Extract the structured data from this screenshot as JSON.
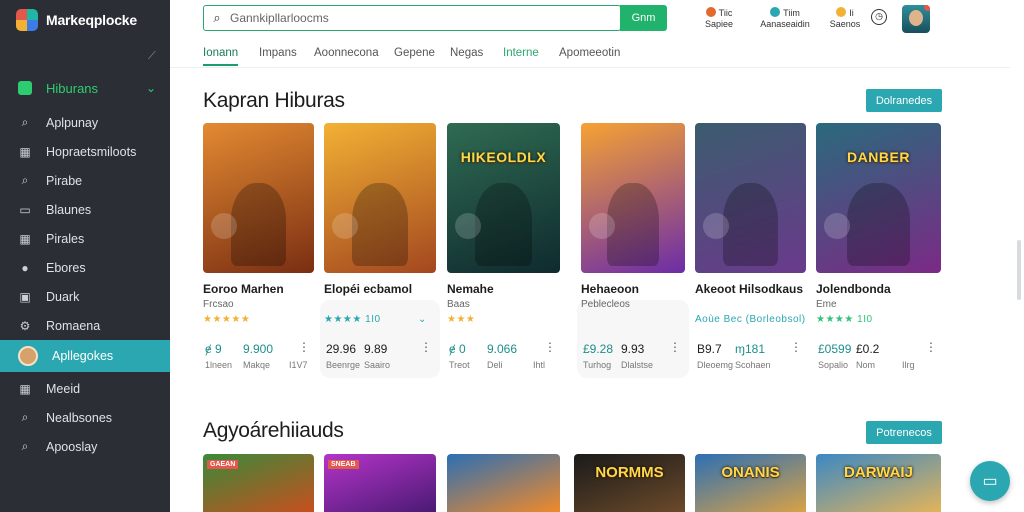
{
  "app": {
    "name": "Markeqplocke"
  },
  "sidebar": {
    "section": {
      "label": "Hiburans"
    },
    "items": [
      {
        "label": "Aplpunay",
        "icon": "search-icon"
      },
      {
        "label": "Hopraetsmiloots",
        "icon": "grid-icon"
      },
      {
        "label": "Pirabe",
        "icon": "search-icon"
      },
      {
        "label": "Blaunes",
        "icon": "chat-icon"
      },
      {
        "label": "Pirales",
        "icon": "grid-icon"
      },
      {
        "label": "Ebores",
        "icon": "user-icon"
      },
      {
        "label": "Duark",
        "icon": "monitor-icon"
      },
      {
        "label": "Romaena",
        "icon": "settings-icon"
      },
      {
        "label": "Apllegokes",
        "icon": "avatar-icon",
        "active": true
      },
      {
        "label": "Meeid",
        "icon": "grid-icon"
      },
      {
        "label": "Nealbsones",
        "icon": "search-icon"
      },
      {
        "label": "Apooslay",
        "icon": "search-icon"
      }
    ]
  },
  "search": {
    "placeholder": "Gannkipllarloocms",
    "button_label": "Gnm"
  },
  "topbar": {
    "stats": [
      {
        "top": "Tiic",
        "bottom": "Sapiee",
        "color": "#e26a2c"
      },
      {
        "top": "Tiim",
        "bottom": "Aanaseaidin",
        "color": "#2aa7b0"
      },
      {
        "top": "Ii",
        "bottom": "Saenos",
        "color": "#f2b134"
      }
    ]
  },
  "tabs": [
    {
      "label": "Ionann",
      "active": true
    },
    {
      "label": "Impans"
    },
    {
      "label": "Aoonnecona"
    },
    {
      "label": "Gepene"
    },
    {
      "label": "Negas"
    },
    {
      "label": "Interne",
      "green": true
    },
    {
      "label": "Apomeeotin"
    }
  ],
  "sections": [
    {
      "title": "Kapran Hiburas",
      "button": "Dolranedes"
    },
    {
      "title": "Agyoárehiiauds",
      "button": "Potrenecos"
    }
  ],
  "cards": [
    {
      "title": "Eoroo Marhen",
      "subtitle": "Frcsao",
      "rating": "★★★★★",
      "rating_style": "gold",
      "stats": [
        {
          "value": "ɇ 9",
          "label": "1lneen",
          "teal": true
        },
        {
          "value": "9.900",
          "label": "Makqe",
          "teal": true
        }
      ],
      "extra": "I1V7",
      "colors": [
        "#e38a32",
        "#7a2e12"
      ],
      "logo": ""
    },
    {
      "title": "Elopéi ecbamol",
      "subtitle": "",
      "rating": "★★★★  1I0",
      "rating_style": "teal",
      "stats": [
        {
          "value": "29.96",
          "label": "Beenrge"
        },
        {
          "value": "9.89",
          "label": "Saairo"
        }
      ],
      "extra": "",
      "colors": [
        "#f2b134",
        "#a3471f"
      ],
      "logo": ""
    },
    {
      "title": "Nemahe",
      "subtitle": "Baas",
      "rating": "★★★",
      "rating_style": "gold",
      "stats": [
        {
          "value": "ɇ 0",
          "label": "Treot",
          "teal": true
        },
        {
          "value": "9.066",
          "label": "Deli",
          "teal": true
        }
      ],
      "extra": "Ihtl",
      "colors": [
        "#2f6b52",
        "#0f2a2e"
      ],
      "logo": "HIKEOLDLX"
    },
    {
      "title": "Hehaeoon",
      "subtitle": "Peblecleos",
      "rating": "",
      "rating_style": "gold",
      "stats": [
        {
          "value": "£9.28",
          "label": "Turhog",
          "teal": true
        },
        {
          "value": "9.93",
          "label": "Dlalstse"
        }
      ],
      "extra": "",
      "colors": [
        "#f6a232",
        "#6b2ca8"
      ],
      "logo": ""
    },
    {
      "title": "Akeoot Hilsodkaus",
      "subtitle": "",
      "rating": "Aoùe Bec (Borleobsol)",
      "rating_style": "teal",
      "stats": [
        {
          "value": "B9.7",
          "label": "Dleoemg"
        },
        {
          "value": "ɱ181",
          "label": "Scohaen",
          "teal": true
        }
      ],
      "extra": "",
      "colors": [
        "#3b5c6e",
        "#6a3a8c"
      ],
      "logo": ""
    },
    {
      "title": "Jolendbonda",
      "subtitle": "Eme",
      "rating": "★★★★  1I0",
      "rating_style": "green",
      "stats": [
        {
          "value": "£0599",
          "label": "Sopalio",
          "teal": true
        },
        {
          "value": "£0.2",
          "label": "Nom"
        }
      ],
      "extra": "Ilrg",
      "colors": [
        "#2a6a7c",
        "#7b2a86"
      ],
      "logo": "DANBER"
    }
  ],
  "cards2": [
    {
      "tag": "GAEAN",
      "logo": "",
      "colors": [
        "#3a8a3a",
        "#c74f1e"
      ]
    },
    {
      "tag": "SNEAB",
      "logo": "",
      "colors": [
        "#b534c8",
        "#4a1a74"
      ]
    },
    {
      "tag": "",
      "logo": "",
      "colors": [
        "#2c6fb4",
        "#f08a2a"
      ]
    },
    {
      "tag": "",
      "logo": "NORMMS",
      "colors": [
        "#1a1a1a",
        "#6b4a2a"
      ]
    },
    {
      "tag": "",
      "logo": "ONANIS",
      "colors": [
        "#2c6fb4",
        "#d9a246"
      ]
    },
    {
      "tag": "",
      "logo": "DARWAIJ",
      "colors": [
        "#3b88c4",
        "#e2b45a"
      ]
    }
  ]
}
